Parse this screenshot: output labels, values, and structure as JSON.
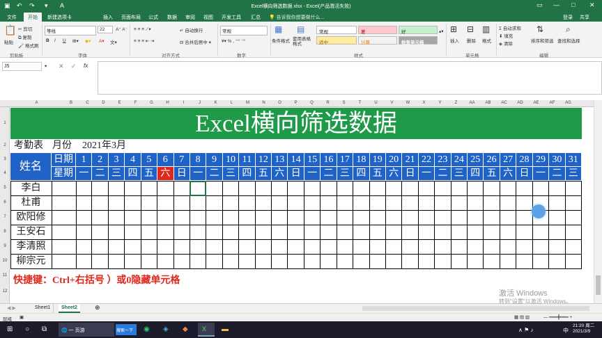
{
  "window": {
    "title": "Excel横向筛选数据.xlsx - Excel(产品激活失败)",
    "colors": {
      "brand": "#217346",
      "header_blue": "#1f62c8",
      "title_green": "#1e9a48",
      "sat_red": "#e0281d"
    }
  },
  "quick_access": {
    "save_icon": "save-icon",
    "undo_icon": "undo-icon",
    "redo_icon": "redo-icon"
  },
  "ribbon_tabs": [
    "文件",
    "开始",
    "新建选项卡",
    "插入",
    "页面布局",
    "公式",
    "数据",
    "审阅",
    "视图",
    "开发工具",
    "汇总"
  ],
  "tell_me": "告诉我你想要做什么...",
  "account": {
    "login": "登录",
    "share": "共享"
  },
  "clipboard": {
    "paste": "粘贴",
    "cut": "剪切",
    "copy": "复制",
    "painter": "格式刷",
    "group": "剪贴板"
  },
  "font": {
    "name": "等线",
    "size": "22",
    "group": "字体",
    "bold": "B",
    "italic": "I",
    "underline": "U"
  },
  "alignment": {
    "wrap": "自动换行",
    "merge": "合并后居中",
    "group": "对齐方式"
  },
  "number": {
    "format": "常规",
    "group": "数字"
  },
  "styles": {
    "cond": "条件格式",
    "table": "套用表格格式",
    "normal": "常规",
    "bad": "差",
    "good": "好",
    "neutral": "适中",
    "calc": "计算",
    "check": "检查单元格",
    "group": "样式"
  },
  "cells": {
    "insert": "插入",
    "delete": "删除",
    "format": "格式",
    "group": "单元格"
  },
  "editing": {
    "autosum": "自动求和",
    "fill": "填充",
    "clear": "清除",
    "sort": "排序和筛选",
    "find": "查找和选择",
    "group": "编辑"
  },
  "formula_bar": {
    "cell_ref": "J5",
    "formula": ""
  },
  "columns": [
    "A",
    "B",
    "C",
    "D",
    "E",
    "F",
    "G",
    "H",
    "I",
    "J",
    "K",
    "L",
    "M",
    "N",
    "O",
    "P",
    "Q",
    "R",
    "S",
    "T",
    "U",
    "V",
    "W",
    "X",
    "Y",
    "Z",
    "AA",
    "AB",
    "AC",
    "AD",
    "AE",
    "AF",
    "AG"
  ],
  "rows": [
    "1",
    "2",
    "3",
    "4",
    "5",
    "6",
    "7",
    "8",
    "9",
    "10",
    "11",
    "12"
  ],
  "sheet": {
    "title": "Excel横向筛选数据",
    "row2": {
      "label": "考勤表",
      "month_label": "月份",
      "month": "2021年3月"
    },
    "name_header": "姓名",
    "date_label": "日期",
    "week_label": "星期",
    "days": [
      "1",
      "2",
      "3",
      "4",
      "5",
      "6",
      "7",
      "8",
      "9",
      "10",
      "11",
      "12",
      "13",
      "14",
      "15",
      "16",
      "17",
      "18",
      "19",
      "20",
      "21",
      "22",
      "23",
      "24",
      "25",
      "26",
      "27",
      "28",
      "29",
      "30",
      "31"
    ],
    "weekdays": [
      "一",
      "二",
      "三",
      "四",
      "五",
      "六",
      "日",
      "一",
      "二",
      "三",
      "四",
      "五",
      "六",
      "日",
      "一",
      "二",
      "三",
      "四",
      "五",
      "六",
      "日",
      "一",
      "二",
      "三",
      "四",
      "五",
      "六",
      "日",
      "一",
      "二",
      "三"
    ],
    "names": [
      "李白",
      "杜甫",
      "欧阳修",
      "王安石",
      "李清照",
      "柳宗元"
    ],
    "shortcut_note": "快捷键：Ctrl+右括号 ）或0隐藏单元格"
  },
  "sheet_tabs": [
    "Sheet1",
    "Sheet2"
  ],
  "active_sheet": "Sheet2",
  "status": {
    "ready": "就绪"
  },
  "watermark": {
    "line1": "激活 Windows",
    "line2": "转到\"设置\"以激活 Windows。"
  },
  "taskbar": {
    "search_btn": "搜索一下",
    "browser_label": "一 页游",
    "time": "21:20 周二",
    "date": "2021/3/9",
    "ime": "中"
  }
}
